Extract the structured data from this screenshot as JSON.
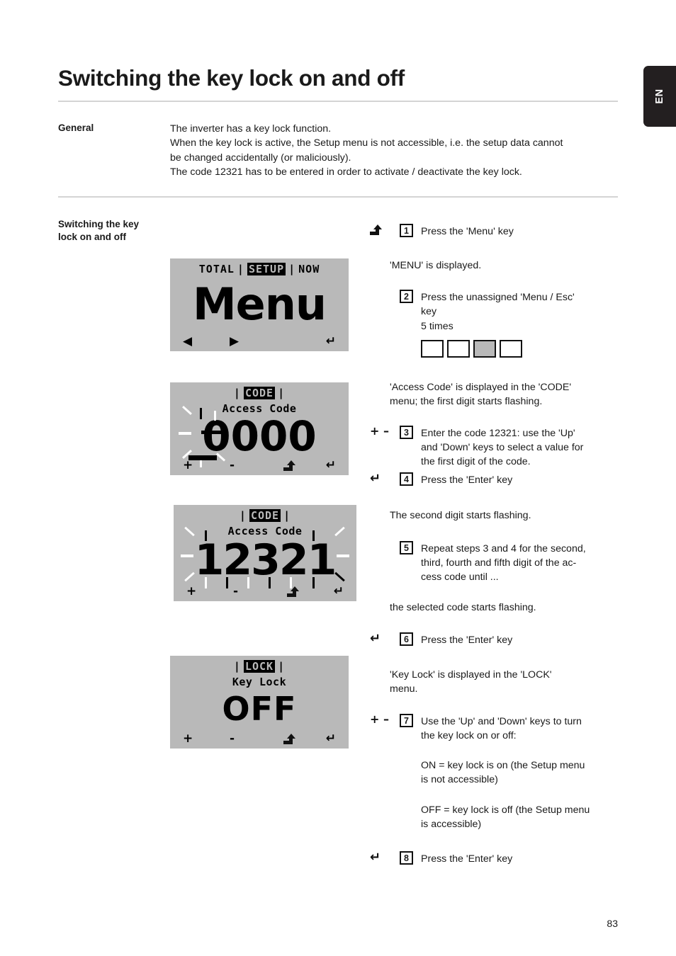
{
  "language_tab": "EN",
  "page_title": "Switching the key lock on and off",
  "page_number": "83",
  "general": {
    "label": "General",
    "line1": "The inverter has a key lock function.",
    "line2": "When the key lock is active, the Setup menu is not accessible, i.e. the setup data cannot",
    "line3": "be changed accidentally (or maliciously).",
    "line4": "The code 12321 has to be entered in order to activate / deactivate the key lock."
  },
  "procedure": {
    "label_line1": "Switching the key",
    "label_line2": "lock on and off"
  },
  "lcd_displays": [
    {
      "name": "menu-display",
      "header_left": "TOTAL",
      "header_center": "SETUP",
      "header_right": "NOW",
      "sub": "",
      "big": "Menu",
      "footer": [
        "◀",
        "▶",
        "",
        "↵"
      ]
    },
    {
      "name": "access-code-0000-display",
      "header_left": "",
      "header_center": "CODE",
      "header_right": "",
      "sub": "Access Code",
      "big": "0000",
      "footer": [
        "+",
        "-",
        "menu-esc",
        "↵"
      ]
    },
    {
      "name": "access-code-12321-display",
      "header_left": "",
      "header_center": "CODE",
      "header_right": "",
      "sub": "Access Code",
      "big": "12321",
      "footer": [
        "+",
        "-",
        "menu-esc",
        "↵"
      ]
    },
    {
      "name": "key-lock-off-display",
      "header_left": "",
      "header_center": "LOCK",
      "header_right": "",
      "sub": "Key Lock",
      "big": "OFF",
      "footer": [
        "+",
        "-",
        "menu-esc",
        "↵"
      ]
    }
  ],
  "steps": [
    {
      "num": "1",
      "key": "menu-esc",
      "text": "Press the 'Menu' key"
    },
    {
      "num": "2",
      "key": "",
      "text": "Press the unassigned 'Menu / Esc' key\n5 times"
    },
    {
      "num": "3",
      "key": "+ –",
      "text": "Enter the code 12321: use the 'Up' and 'Down' keys to select a value for the first digit of the code."
    },
    {
      "num": "4",
      "key": "↵",
      "text": "Press the 'Enter' key"
    },
    {
      "num": "5",
      "key": "",
      "text": "Repeat steps 3 and 4 for the second, third, fourth and fifth digit of the ac-cess code until ..."
    },
    {
      "num": "6",
      "key": "↵",
      "text": "Press the 'Enter' key"
    },
    {
      "num": "7",
      "key": "+ –",
      "text": "Use the 'Up' and 'Down' keys to turn the key lock on or off:"
    },
    {
      "num": "8",
      "key": "↵",
      "text": "Press the 'Enter' key"
    }
  ],
  "step_text": {
    "s1": "Press the 'Menu' key",
    "note1": "'MENU' is displayed.",
    "s2_l1": "Press the unassigned 'Menu / Esc'",
    "s2_l2": "key",
    "s2_l3": "5 times",
    "note2_l1": "'Access Code' is displayed in the 'CODE'",
    "note2_l2": "menu; the first digit starts flashing.",
    "s3_l1": "Enter the code 12321: use the 'Up'",
    "s3_l2": "and 'Down' keys to select a value for",
    "s3_l3": "the first digit of the code.",
    "s4": "Press the 'Enter' key",
    "note3": "The second digit starts flashing.",
    "s5_l1": "Repeat steps 3 and 4 for the second,",
    "s5_l2": "third, fourth and fifth digit of the ac-",
    "s5_l3": "cess code until ...",
    "note4": "the selected code starts flashing.",
    "s6": "Press the 'Enter' key",
    "note5_l1": "'Key Lock' is displayed in the 'LOCK'",
    "note5_l2": "menu.",
    "s7_l1": "Use the 'Up' and 'Down' keys to turn",
    "s7_l2": "the key lock on or off:",
    "on_l1": "ON = key lock is on (the Setup menu",
    "on_l2": "is not accessible)",
    "off_l1": "OFF = key lock is off (the Setup menu",
    "off_l2": "is accessible)",
    "s8": "Press the 'Enter' key"
  },
  "keyrow": {
    "boxes": [
      "",
      "",
      "",
      ""
    ],
    "active_index": 2,
    "active_color": "#b9b9b9"
  },
  "step_numbers": {
    "n1": "1",
    "n2": "2",
    "n3": "3",
    "n4": "4",
    "n5": "5",
    "n6": "6",
    "n7": "7",
    "n8": "8"
  },
  "key_glyphs": {
    "plusminus": "+ –",
    "enter": "↵"
  },
  "colors": {
    "lcd_background": "#b9b9b9",
    "tab_background": "#231f20",
    "rule": "#d4d4d4",
    "text": "#1a1a1a"
  }
}
